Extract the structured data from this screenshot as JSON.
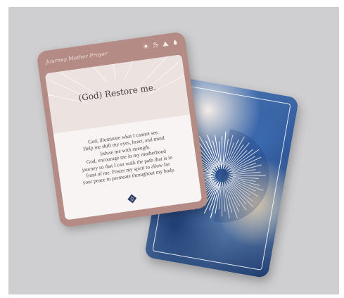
{
  "front_card": {
    "brand": "Journey Mother Prayer",
    "title": "(God) Restore me.",
    "prayer_lines": [
      "God, illuminate what I cannot see.",
      "Help me shift my eyes, heart, and mind.",
      "Infuse me with strength.",
      "God, encourage me in my motherhood",
      "journey so that I can walk the path that is in",
      "front of me. Foster my spirit to allow for",
      "your peace to permeate throughout my body."
    ],
    "header_icons": [
      "sun-icon",
      "people-icon",
      "mountain-icon",
      "drop-icon"
    ],
    "emblem_icon": "diamond-emblem-icon",
    "colors": {
      "border": "#b58b85",
      "text": "#44403f",
      "accent": "#2a3f6e"
    }
  },
  "back_card": {
    "art": "blue watercolor with white starburst",
    "colors": {
      "primary": "#2a4f8c",
      "light": "#f2ece6"
    }
  },
  "background": "#cfced0"
}
